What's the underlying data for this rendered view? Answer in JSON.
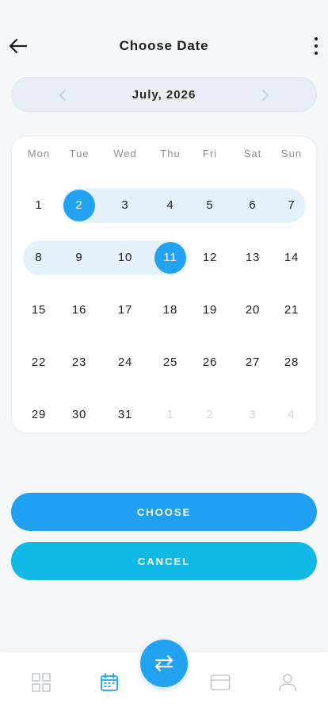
{
  "header": {
    "title": "Choose Date",
    "back_icon": "arrow-left-icon",
    "more_icon": "more-vertical-icon"
  },
  "month_nav": {
    "label": "July, 2026",
    "prev_icon": "chevron-left-icon",
    "next_icon": "chevron-right-icon"
  },
  "calendar": {
    "weekdays": [
      "Mon",
      "Tue",
      "Wed",
      "Thu",
      "Fri",
      "Sat",
      "Sun"
    ],
    "weeks": [
      [
        {
          "d": "1"
        },
        {
          "d": "2",
          "selected": true
        },
        {
          "d": "3",
          "in_range": true
        },
        {
          "d": "4",
          "in_range": true
        },
        {
          "d": "5",
          "in_range": true
        },
        {
          "d": "6",
          "in_range": true
        },
        {
          "d": "7",
          "in_range": true
        }
      ],
      [
        {
          "d": "8",
          "in_range": true
        },
        {
          "d": "9",
          "in_range": true
        },
        {
          "d": "10",
          "in_range": true
        },
        {
          "d": "11",
          "selected": true
        },
        {
          "d": "12"
        },
        {
          "d": "13"
        },
        {
          "d": "14"
        }
      ],
      [
        {
          "d": "15"
        },
        {
          "d": "16"
        },
        {
          "d": "17"
        },
        {
          "d": "18"
        },
        {
          "d": "19"
        },
        {
          "d": "20"
        },
        {
          "d": "21"
        }
      ],
      [
        {
          "d": "22"
        },
        {
          "d": "23"
        },
        {
          "d": "24"
        },
        {
          "d": "25"
        },
        {
          "d": "26"
        },
        {
          "d": "27"
        },
        {
          "d": "28"
        }
      ],
      [
        {
          "d": "29"
        },
        {
          "d": "30"
        },
        {
          "d": "31"
        },
        {
          "d": "1",
          "outside": true
        },
        {
          "d": "2",
          "outside": true
        },
        {
          "d": "3",
          "outside": true
        },
        {
          "d": "4",
          "outside": true
        }
      ]
    ],
    "range_start": "2",
    "range_end": "11"
  },
  "actions": {
    "choose_label": "CHOOSE",
    "cancel_label": "CANCEL"
  },
  "bottom_nav": {
    "items": [
      {
        "icon": "grid-icon",
        "active": false
      },
      {
        "icon": "calendar-icon",
        "active": true
      },
      {
        "icon": "card-icon",
        "active": false
      },
      {
        "icon": "user-icon",
        "active": false
      }
    ],
    "fab_icon": "swap-arrows-icon"
  },
  "colors": {
    "accent": "#22a3f1",
    "cancel": "#12b8e6",
    "range_band": "#e4f2fc",
    "background": "#f6f7f9",
    "inactive_icon": "#c5c9cf",
    "outside_day": "#d2d4d8"
  }
}
